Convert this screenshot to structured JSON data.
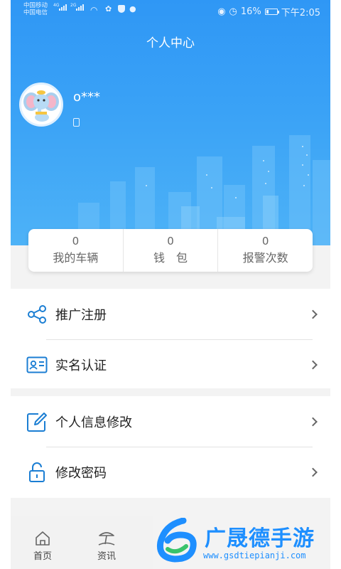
{
  "status_bar": {
    "carrier1": "中国移动",
    "carrier2": "中国电信",
    "net1": "4G",
    "net2": "2G",
    "battery": "16%",
    "time": "下午2:05"
  },
  "header": {
    "title": "个人中心",
    "username": "o***"
  },
  "stats": [
    {
      "value": "0",
      "label": "我的车辆"
    },
    {
      "value": "0",
      "label": "钱　包"
    },
    {
      "value": "0",
      "label": "报警次数"
    }
  ],
  "menu": {
    "group1": [
      {
        "label": "推广注册",
        "icon": "share-icon"
      },
      {
        "label": "实名认证",
        "icon": "id-card-icon"
      }
    ],
    "group2": [
      {
        "label": "个人信息修改",
        "icon": "edit-icon"
      },
      {
        "label": "修改密码",
        "icon": "lock-icon"
      }
    ]
  },
  "tabbar": {
    "tabs": [
      {
        "label": "首页",
        "icon": "home-icon"
      },
      {
        "label": "资讯",
        "icon": "news-icon"
      }
    ]
  },
  "watermark": {
    "text": "广晟德手游",
    "url": "www.gsdtiepianji.com"
  },
  "colors": {
    "header_blue": "#3aa2f6",
    "icon_blue": "#1b7ed3",
    "watermark_blue": "#1e8fff"
  }
}
